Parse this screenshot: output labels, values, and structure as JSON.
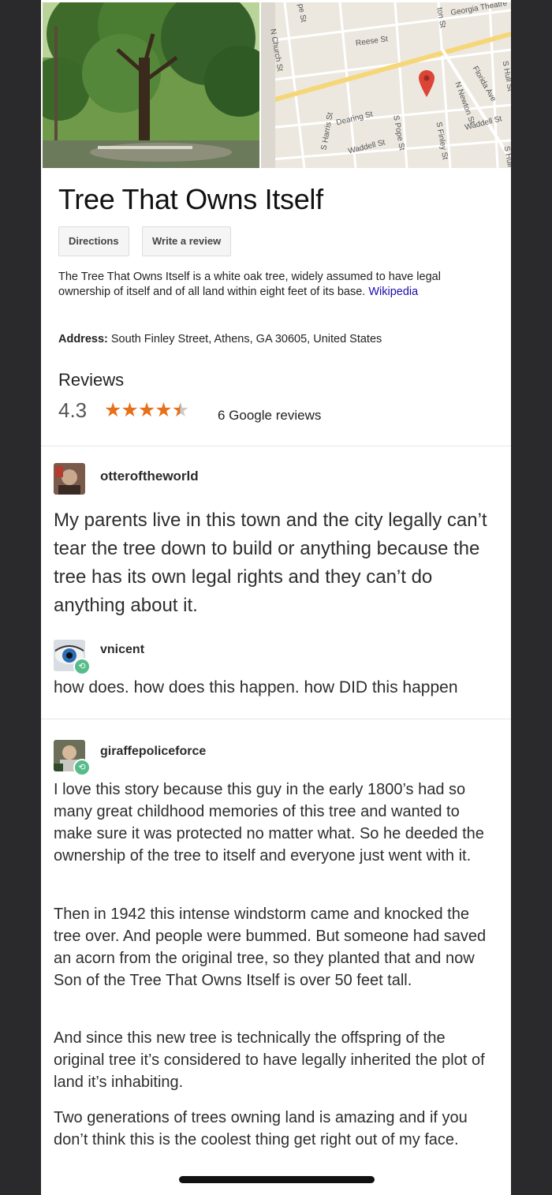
{
  "map": {
    "streets": [
      "pe St",
      "N Church St",
      "Reese St",
      "Dearing St",
      "S Harris St",
      "Waddell St",
      "S Pope St",
      "S Finley St",
      "ton St",
      "N Newton St",
      "Florida Ave",
      "Waddell St",
      "S Hull St",
      "S Hull",
      "Georgia Theatre"
    ]
  },
  "place": {
    "title": "Tree That Owns Itself",
    "directions_label": "Directions",
    "review_label": "Write a review",
    "description": "The Tree That Owns Itself is a white oak tree, widely assumed to have legal ownership of itself and of all land within eight feet of its base.",
    "source": "Wikipedia",
    "address_label": "Address:",
    "address": "South Finley Street, Athens, GA 30605, United States",
    "reviews_heading": "Reviews",
    "rating": "4.3",
    "rating_value": 4.3,
    "rating_max": 5,
    "reviews_count": "6 Google reviews",
    "star_color": "#e7711b"
  },
  "posts": [
    {
      "username": "otteroftheworld",
      "text": "My parents live in this town and the city legally can’t tear the tree down to build or anything because the tree has its own legal rights and they can’t do anything about it."
    },
    {
      "username": "vnicent",
      "text": "how does. how does this happen. how DID this happen"
    },
    {
      "username": "giraffepoliceforce",
      "paragraphs": [
        "I love this story because this guy in the early 1800’s had so many great childhood memories of this tree and wanted to make sure it was protected no matter what. So he deeded the ownership of the tree to itself and everyone just went with it.",
        "Then in 1942 this intense windstorm came and knocked the tree over. And people were bummed. But someone had saved an acorn from the original tree, so they planted that and now Son of the Tree That Owns Itself is over 50 feet tall.",
        "And since this new tree is technically the offspring of the original tree it’s considered to have legally inherited the plot of land it’s inhabiting.",
        "Two generations of trees owning land is amazing and if you don’t think this is the coolest thing get right out of my face."
      ]
    }
  ],
  "colors": {
    "reblog_badge": "#56bc8a",
    "link": "#1a0dab"
  }
}
